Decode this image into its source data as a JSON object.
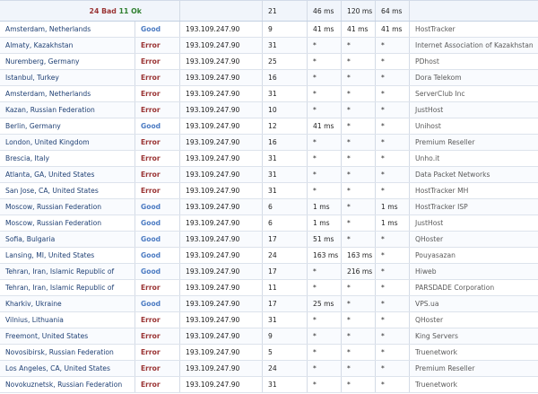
{
  "summary": {
    "bad_label": "24 Bad",
    "ok_label": "11 Ok",
    "hop": "21",
    "t1": "46 ms",
    "t2": "120 ms",
    "t3": "64 ms"
  },
  "colors": {
    "good": "#4d7cc3",
    "error": "#9a3434",
    "ok": "#2f7f2f"
  },
  "rows": [
    {
      "location": "Amsterdam, Netherlands",
      "status": "Good",
      "ip": "193.109.247.90",
      "hop": "9",
      "t1": "41 ms",
      "t2": "41 ms",
      "t3": "41 ms",
      "host": "HostTracker"
    },
    {
      "location": "Almaty, Kazakhstan",
      "status": "Error",
      "ip": "193.109.247.90",
      "hop": "31",
      "t1": "*",
      "t2": "*",
      "t3": "*",
      "host": "Internet Association of Kazakhstan"
    },
    {
      "location": "Nuremberg, Germany",
      "status": "Error",
      "ip": "193.109.247.90",
      "hop": "25",
      "t1": "*",
      "t2": "*",
      "t3": "*",
      "host": "PDhost"
    },
    {
      "location": "Istanbul, Turkey",
      "status": "Error",
      "ip": "193.109.247.90",
      "hop": "16",
      "t1": "*",
      "t2": "*",
      "t3": "*",
      "host": "Dora Telekom"
    },
    {
      "location": "Amsterdam, Netherlands",
      "status": "Error",
      "ip": "193.109.247.90",
      "hop": "31",
      "t1": "*",
      "t2": "*",
      "t3": "*",
      "host": "ServerClub Inc"
    },
    {
      "location": "Kazan, Russian Federation",
      "status": "Error",
      "ip": "193.109.247.90",
      "hop": "10",
      "t1": "*",
      "t2": "*",
      "t3": "*",
      "host": "JustHost"
    },
    {
      "location": "Berlin, Germany",
      "status": "Good",
      "ip": "193.109.247.90",
      "hop": "12",
      "t1": "41 ms",
      "t2": "*",
      "t3": "*",
      "host": "Unihost"
    },
    {
      "location": "London, United Kingdom",
      "status": "Error",
      "ip": "193.109.247.90",
      "hop": "16",
      "t1": "*",
      "t2": "*",
      "t3": "*",
      "host": "Premium Reseller"
    },
    {
      "location": "Brescia, Italy",
      "status": "Error",
      "ip": "193.109.247.90",
      "hop": "31",
      "t1": "*",
      "t2": "*",
      "t3": "*",
      "host": "Unho.it"
    },
    {
      "location": "Atlanta, GA, United States",
      "status": "Error",
      "ip": "193.109.247.90",
      "hop": "31",
      "t1": "*",
      "t2": "*",
      "t3": "*",
      "host": "Data Packet Networks"
    },
    {
      "location": "San Jose, CA, United States",
      "status": "Error",
      "ip": "193.109.247.90",
      "hop": "31",
      "t1": "*",
      "t2": "*",
      "t3": "*",
      "host": "HostTracker MH"
    },
    {
      "location": "Moscow, Russian Federation",
      "status": "Good",
      "ip": "193.109.247.90",
      "hop": "6",
      "t1": "1 ms",
      "t2": "*",
      "t3": "1 ms",
      "host": "HostTracker ISP"
    },
    {
      "location": "Moscow, Russian Federation",
      "status": "Good",
      "ip": "193.109.247.90",
      "hop": "6",
      "t1": "1 ms",
      "t2": "*",
      "t3": "1 ms",
      "host": "JustHost"
    },
    {
      "location": "Sofia, Bulgaria",
      "status": "Good",
      "ip": "193.109.247.90",
      "hop": "17",
      "t1": "51 ms",
      "t2": "*",
      "t3": "*",
      "host": "QHoster"
    },
    {
      "location": "Lansing, MI, United States",
      "status": "Good",
      "ip": "193.109.247.90",
      "hop": "24",
      "t1": "163 ms",
      "t2": "163 ms",
      "t3": "*",
      "host": "Pouyasazan"
    },
    {
      "location": "Tehran, Iran, Islamic Republic of",
      "status": "Good",
      "ip": "193.109.247.90",
      "hop": "17",
      "t1": "*",
      "t2": "216 ms",
      "t3": "*",
      "host": "Hiweb"
    },
    {
      "location": "Tehran, Iran, Islamic Republic of",
      "status": "Error",
      "ip": "193.109.247.90",
      "hop": "11",
      "t1": "*",
      "t2": "*",
      "t3": "*",
      "host": "PARSDADE Corporation"
    },
    {
      "location": "Kharkiv, Ukraine",
      "status": "Good",
      "ip": "193.109.247.90",
      "hop": "17",
      "t1": "25 ms",
      "t2": "*",
      "t3": "*",
      "host": "VPS.ua"
    },
    {
      "location": "Vilnius, Lithuania",
      "status": "Error",
      "ip": "193.109.247.90",
      "hop": "31",
      "t1": "*",
      "t2": "*",
      "t3": "*",
      "host": "QHoster"
    },
    {
      "location": "Freemont, United States",
      "status": "Error",
      "ip": "193.109.247.90",
      "hop": "9",
      "t1": "*",
      "t2": "*",
      "t3": "*",
      "host": "King Servers"
    },
    {
      "location": "Novosibirsk, Russian Federation",
      "status": "Error",
      "ip": "193.109.247.90",
      "hop": "5",
      "t1": "*",
      "t2": "*",
      "t3": "*",
      "host": "Truenetwork"
    },
    {
      "location": "Los Angeles, CA, United States",
      "status": "Error",
      "ip": "193.109.247.90",
      "hop": "24",
      "t1": "*",
      "t2": "*",
      "t3": "*",
      "host": "Premium Reseller"
    },
    {
      "location": "Novokuznetsk, Russian Federation",
      "status": "Error",
      "ip": "193.109.247.90",
      "hop": "31",
      "t1": "*",
      "t2": "*",
      "t3": "*",
      "host": "Truenetwork"
    }
  ]
}
